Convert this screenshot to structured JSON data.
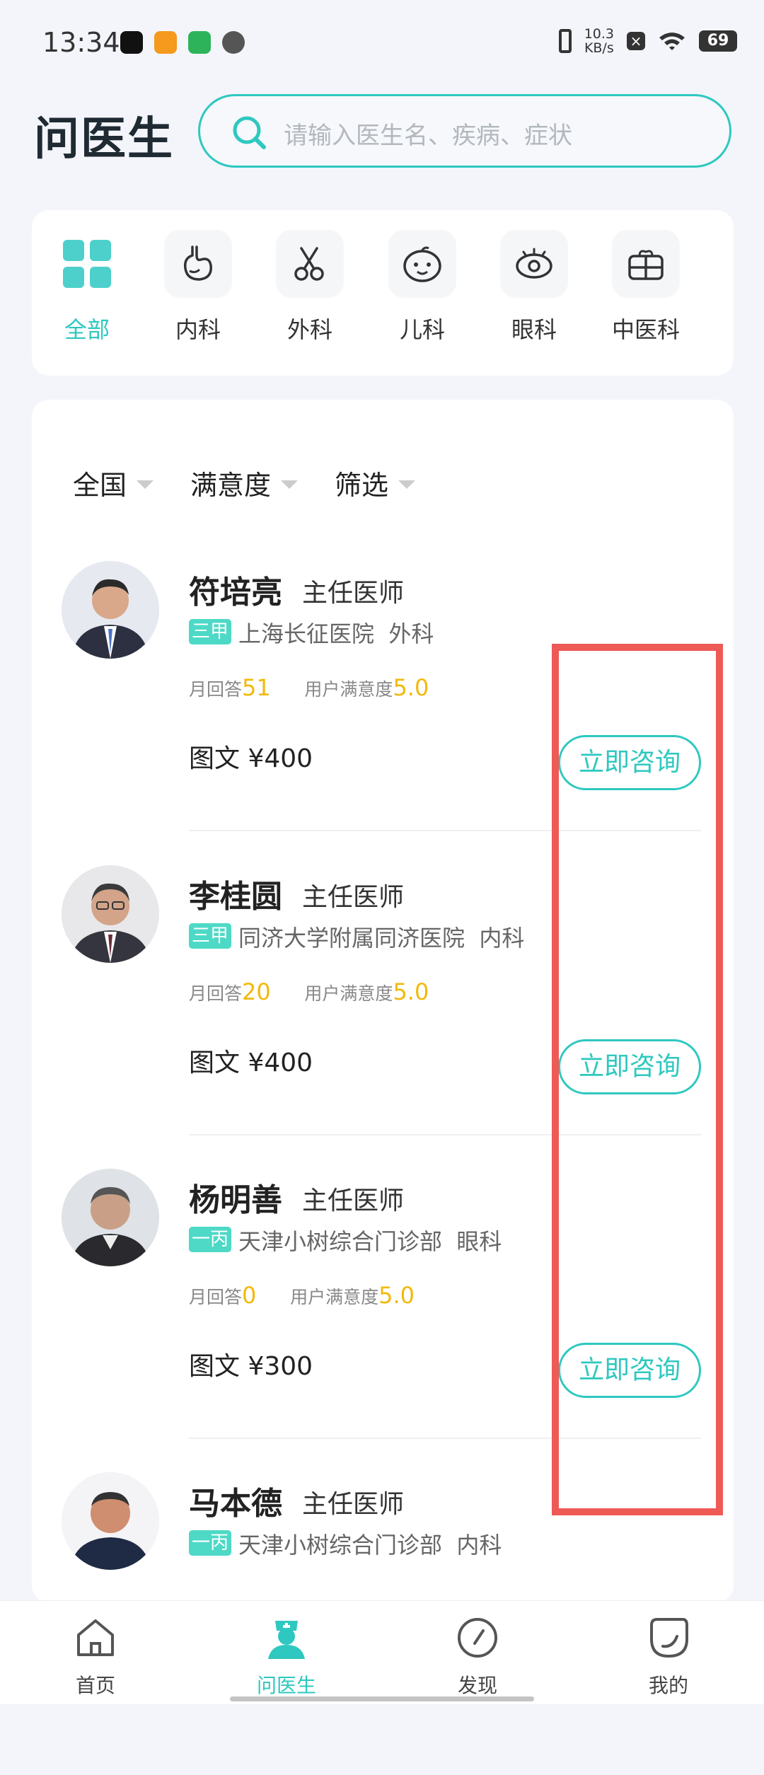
{
  "status_bar": {
    "time": "13:34",
    "net_speed_top": "10.3",
    "net_speed_unit": "KB/s",
    "battery": "69"
  },
  "header": {
    "title": "问医生",
    "search_placeholder": "请输入医生名、疾病、症状"
  },
  "categories": [
    {
      "label": "全部",
      "icon": "grid-icon",
      "active": true
    },
    {
      "label": "内科",
      "icon": "stomach-icon"
    },
    {
      "label": "外科",
      "icon": "scissors-icon"
    },
    {
      "label": "儿科",
      "icon": "baby-face-icon"
    },
    {
      "label": "眼科",
      "icon": "eye-icon"
    },
    {
      "label": "中医科",
      "icon": "medicine-box-icon"
    }
  ],
  "filters": [
    "全国",
    "满意度",
    "筛选"
  ],
  "doctors": [
    {
      "name": "符培亮",
      "title": "主任医师",
      "level": "三甲",
      "hospital": "上海长征医院",
      "dept": "外科",
      "monthly_label": "月回答",
      "monthly": "51",
      "sat_label": "用户满意度",
      "satisfaction": "5.0",
      "price": "图文 ¥400",
      "consult": "立即咨询"
    },
    {
      "name": "李桂圆",
      "title": "主任医师",
      "level": "三甲",
      "hospital": "同济大学附属同济医院",
      "dept": "内科",
      "monthly_label": "月回答",
      "monthly": "20",
      "sat_label": "用户满意度",
      "satisfaction": "5.0",
      "price": "图文 ¥400",
      "consult": "立即咨询"
    },
    {
      "name": "杨明善",
      "title": "主任医师",
      "level": "一丙",
      "hospital": "天津小树综合门诊部",
      "dept": "眼科",
      "monthly_label": "月回答",
      "monthly": "0",
      "sat_label": "用户满意度",
      "satisfaction": "5.0",
      "price": "图文 ¥300",
      "consult": "立即咨询"
    },
    {
      "name": "马本德",
      "title": "主任医师",
      "level": "一丙",
      "hospital": "天津小树综合门诊部",
      "dept": "内科"
    }
  ],
  "bottom_nav": [
    {
      "label": "首页",
      "icon": "home-icon"
    },
    {
      "label": "问医生",
      "icon": "nurse-icon",
      "active": true
    },
    {
      "label": "发现",
      "icon": "compass-icon"
    },
    {
      "label": "我的",
      "icon": "profile-icon"
    }
  ],
  "colors": {
    "accent": "#2ec8c0",
    "highlight": "#ee5a55",
    "stat_number": "#f2b90b"
  }
}
